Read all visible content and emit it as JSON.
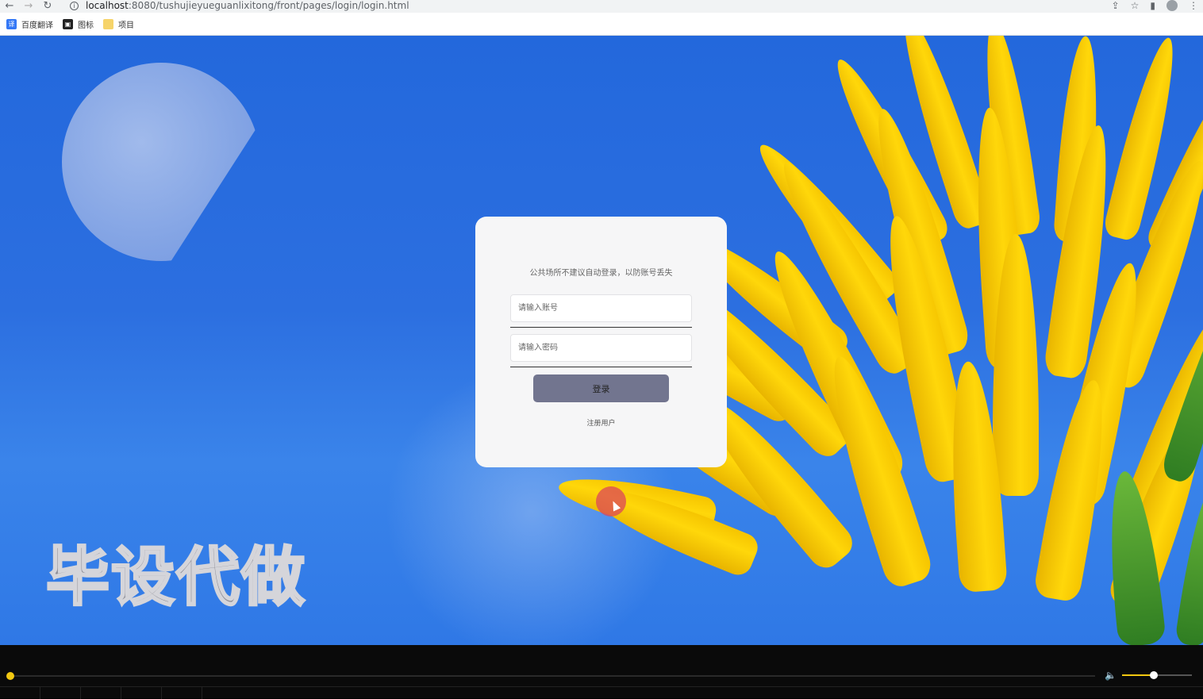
{
  "browser": {
    "url_host": "localhost",
    "url_path": ":8080/tushujieyueguanlixitong/front/pages/login/login.html",
    "bookmarks": [
      {
        "label": "百度翻译",
        "icon": "baidu-translate-icon",
        "glyph": "译"
      },
      {
        "label": "图标",
        "icon": "image-icon",
        "glyph": "▣"
      },
      {
        "label": "项目",
        "icon": "folder-icon",
        "glyph": ""
      }
    ]
  },
  "login": {
    "notice": "公共场所不建议自动登录，以防账号丢失",
    "username_placeholder": "请输入账号",
    "password_placeholder": "请输入密码",
    "login_label": "登录",
    "register_label": "注册用户"
  },
  "watermark": "毕设代做",
  "player": {
    "progress": 0.0,
    "volume": 0.45
  },
  "colors": {
    "sky": "#2c6fe0",
    "button": "#72758f",
    "accent": "#f2c811"
  }
}
